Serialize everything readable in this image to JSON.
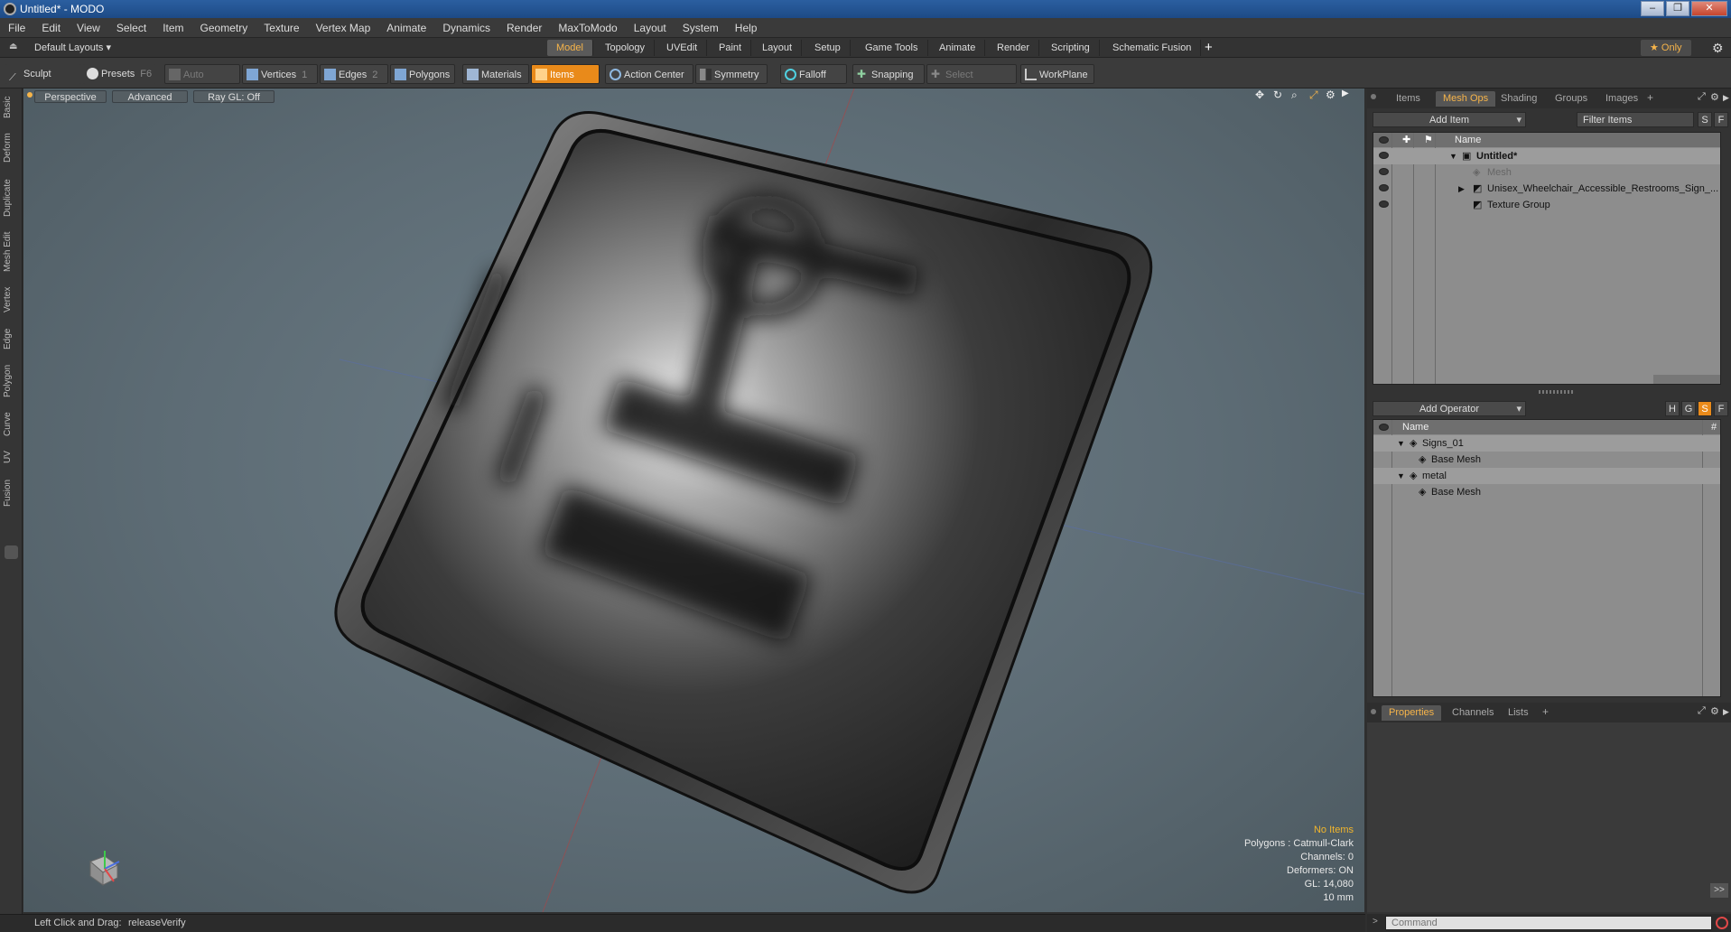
{
  "window": {
    "title": "Untitled* - MODO"
  },
  "menu": [
    "File",
    "Edit",
    "View",
    "Select",
    "Item",
    "Geometry",
    "Texture",
    "Vertex Map",
    "Animate",
    "Dynamics",
    "Render",
    "MaxToModo",
    "Layout",
    "System",
    "Help"
  ],
  "layout_dropdown": "Default Layouts ▾",
  "layout_tabs": [
    "Model",
    "Topology",
    "UVEdit",
    "Paint",
    "Layout",
    "Setup",
    "Game Tools",
    "Animate",
    "Render",
    "Scripting",
    "Schematic Fusion"
  ],
  "layout_active": "Model",
  "layout_add": "+",
  "only_label": "★ Only",
  "toolbar": {
    "sculpt": "Sculpt",
    "presets": "Presets",
    "presets_key": "F6",
    "auto_select": "Auto Select",
    "vertices": "Vertices",
    "vertices_num": "1",
    "edges": "Edges",
    "edges_num": "2",
    "polygons": "Polygons",
    "materials": "Materials",
    "items": "Items",
    "action_center": "Action Center",
    "symmetry": "Symmetry",
    "falloff": "Falloff",
    "snapping": "Snapping",
    "select_through": "Select Through",
    "workplane": "WorkPlane"
  },
  "left_tabs": [
    "Basic",
    "Deform",
    "Duplicate",
    "Mesh Edit",
    "Vertex",
    "Edge",
    "Polygon",
    "Curve",
    "UV",
    "Fusion"
  ],
  "viewport": {
    "perspective": "Perspective",
    "advanced": "Advanced",
    "raygl": "Ray GL: Off",
    "stats": {
      "no_items": "No Items",
      "polygons": "Polygons : Catmull-Clark",
      "channels": "Channels: 0",
      "deformers": "Deformers: ON",
      "gl": "GL: 14,080",
      "unit": "10 mm"
    }
  },
  "items_panel": {
    "tabs": [
      "Items",
      "Mesh Ops",
      "Shading",
      "Groups",
      "Images"
    ],
    "active_tab": "Mesh Ops",
    "add_item": "Add Item",
    "filter_items": "Filter Items",
    "btn_s": "S",
    "btn_f": "F",
    "name_header": "Name",
    "tree": [
      {
        "label": "Untitled*",
        "indent": 0
      },
      {
        "label": "Mesh",
        "indent": 1
      },
      {
        "label": "Unisex_Wheelchair_Accessible_Restrooms_Sign_...",
        "indent": 1
      },
      {
        "label": "Texture Group",
        "indent": 1
      }
    ]
  },
  "ops_panel": {
    "add_operator": "Add Operator",
    "btn_h": "H",
    "btn_g": "G",
    "btn_s": "S",
    "btn_f": "F",
    "name_header": "Name",
    "hash_header": "#",
    "tree": [
      {
        "label": "Signs_01",
        "indent": 0
      },
      {
        "label": "Base Mesh",
        "indent": 1
      },
      {
        "label": "metal",
        "indent": 0
      },
      {
        "label": "Base Mesh",
        "indent": 1
      }
    ]
  },
  "bottom_tabs": [
    "Properties",
    "Channels",
    "Lists"
  ],
  "bottom_active": "Properties",
  "status": {
    "hint": "Left Click and Drag:",
    "action": "releaseVerify"
  },
  "command": {
    "placeholder": "Command"
  },
  "colors": {
    "accent": "#e98a1a",
    "viewport_bg": "#5d6c75",
    "highlight": "#f6b44a"
  }
}
